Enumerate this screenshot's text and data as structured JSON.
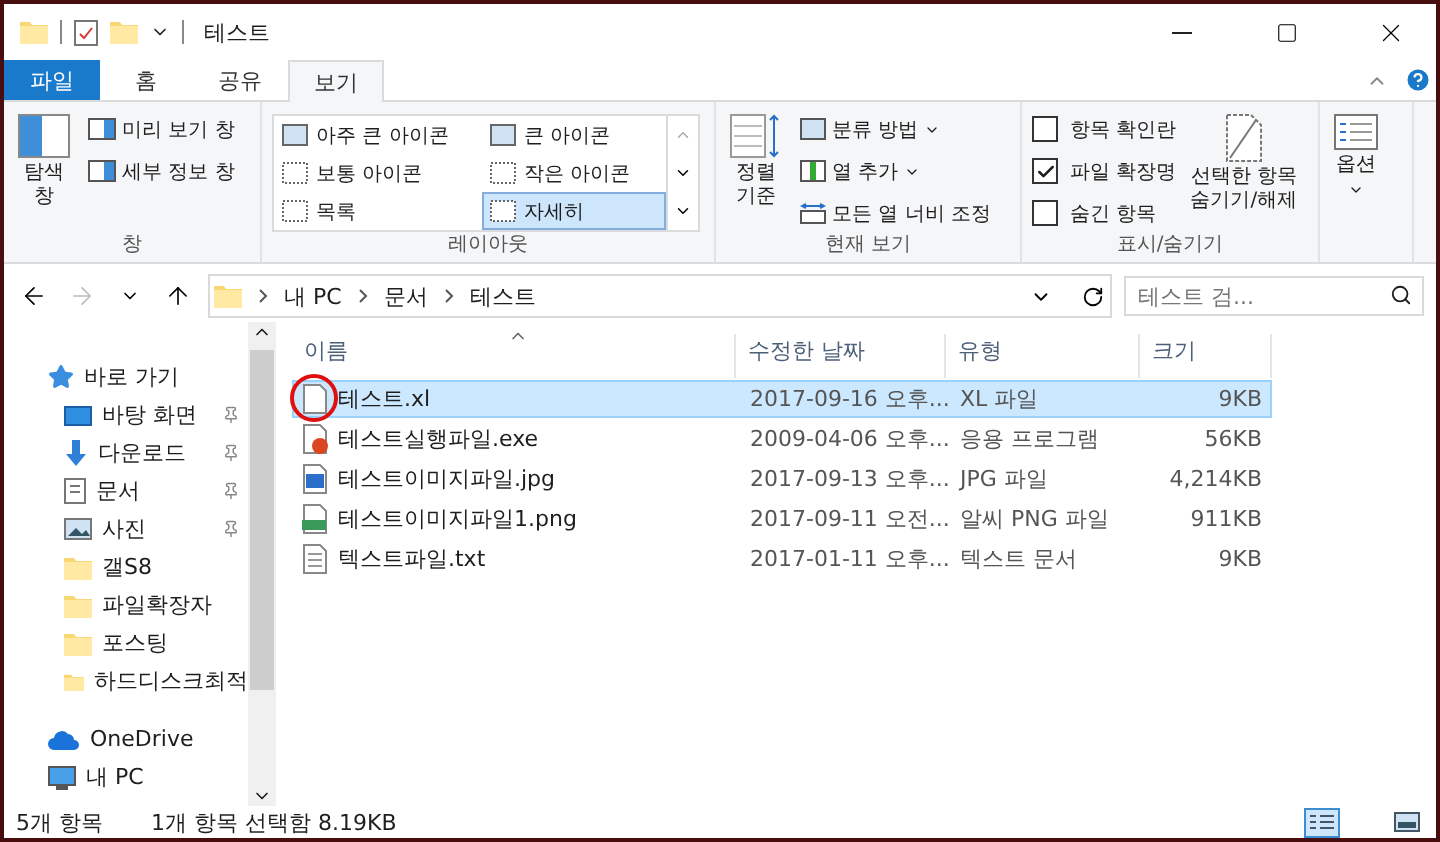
{
  "window": {
    "title": "테스트"
  },
  "ribbon_tabs": [
    {
      "label": "파일",
      "kind": "file",
      "selected": false
    },
    {
      "label": "홈",
      "kind": "tab",
      "selected": false
    },
    {
      "label": "공유",
      "kind": "tab",
      "selected": false
    },
    {
      "label": "보기",
      "kind": "tab",
      "selected": true
    }
  ],
  "ribbon": {
    "panes": {
      "label": "창",
      "nav_pane": "탐색\n창",
      "preview_pane": "미리 보기 창",
      "details_pane": "세부 정보 창"
    },
    "layout": {
      "label": "레이아웃",
      "options": [
        {
          "label": "아주 큰 아이콘",
          "selected": false
        },
        {
          "label": "큰 아이콘",
          "selected": false
        },
        {
          "label": "보통 아이콘",
          "selected": false
        },
        {
          "label": "작은 아이콘",
          "selected": false
        },
        {
          "label": "목록",
          "selected": false
        },
        {
          "label": "자세히",
          "selected": true
        }
      ]
    },
    "current_view": {
      "label": "현재 보기",
      "sort_by": "정렬\n기준",
      "group_by": "분류 방법",
      "add_columns": "열 추가",
      "fit_columns": "모든 열 너비 조정"
    },
    "show_hide": {
      "label": "표시/숨기기",
      "checkboxes": [
        {
          "label": "항목 확인란",
          "checked": false
        },
        {
          "label": "파일 확장명",
          "checked": true
        },
        {
          "label": "숨긴 항목",
          "checked": false
        }
      ],
      "hide_selected": "선택한 항목\n숨기기/해제"
    },
    "options": {
      "label": "옵션"
    }
  },
  "address": {
    "path": [
      "내 PC",
      "문서",
      "테스트"
    ],
    "search_placeholder": "테스트 검..."
  },
  "nav": [
    {
      "label": "바로 가기",
      "kind": "quick",
      "pinned": false
    },
    {
      "label": "바탕 화면",
      "kind": "desktop",
      "pinned": true
    },
    {
      "label": "다운로드",
      "kind": "download",
      "pinned": true
    },
    {
      "label": "문서",
      "kind": "documents",
      "pinned": true
    },
    {
      "label": "사진",
      "kind": "pictures",
      "pinned": true
    },
    {
      "label": "갤S8",
      "kind": "folder",
      "pinned": false
    },
    {
      "label": "파일확장자",
      "kind": "folder",
      "pinned": false
    },
    {
      "label": "포스팅",
      "kind": "folder",
      "pinned": false
    },
    {
      "label": "하드디스크최적",
      "kind": "folder",
      "pinned": false
    },
    {
      "label": "OneDrive",
      "kind": "cloud",
      "pinned": false
    },
    {
      "label": "내 PC",
      "kind": "pc",
      "pinned": false
    }
  ],
  "columns": [
    "이름",
    "수정한 날짜",
    "유형",
    "크기"
  ],
  "files": [
    {
      "name": "테스트.xl",
      "date": "2017-09-16 오후...",
      "type": "XL 파일",
      "size": "9KB",
      "kind": "blank",
      "selected": true
    },
    {
      "name": "테스트실행파일.exe",
      "date": "2009-04-06 오후...",
      "type": "응용 프로그램",
      "size": "56KB",
      "kind": "exe",
      "selected": false
    },
    {
      "name": "테스트이미지파일.jpg",
      "date": "2017-09-13 오후...",
      "type": "JPG 파일",
      "size": "4,214KB",
      "kind": "jpg",
      "selected": false
    },
    {
      "name": "테스트이미지파일1.png",
      "date": "2017-09-11 오전...",
      "type": "알씨 PNG 파일",
      "size": "911KB",
      "kind": "png",
      "selected": false
    },
    {
      "name": "텍스트파일.txt",
      "date": "2017-01-11 오후...",
      "type": "텍스트 문서",
      "size": "9KB",
      "kind": "txt",
      "selected": false
    }
  ],
  "status": {
    "count": "5개 항목",
    "selection": "1개 항목 선택함 8.19KB"
  },
  "view_buttons": [
    {
      "kind": "details",
      "selected": true
    },
    {
      "kind": "tiles",
      "selected": false
    }
  ]
}
